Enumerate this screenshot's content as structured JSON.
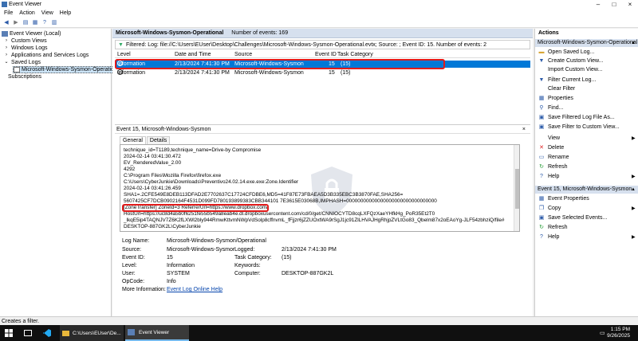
{
  "window": {
    "title": "Event Viewer"
  },
  "menu": [
    "File",
    "Action",
    "View",
    "Help"
  ],
  "tree": {
    "root": "Event Viewer (Local)",
    "items": [
      "Custom Views",
      "Windows Logs",
      "Applications and Services Logs",
      "Saved Logs"
    ],
    "selected": "Microsoft-Windows-Sysmon-Operational",
    "subscriptions": "Subscriptions"
  },
  "log": {
    "name": "Microsoft-Windows-Sysmon-Operational",
    "count_text": "Number of events: 169",
    "filter_text": "Filtered: Log: file://C:\\Users\\EUser\\Desktop\\Challenges\\Microsoft-Windows-Sysmon-Operational.evtx; Source: ; Event ID: 15. Number of events: 2",
    "columns": [
      "Level",
      "Date and Time",
      "Source",
      "Event ID",
      "Task Category"
    ],
    "rows": [
      {
        "level": "Information",
        "date": "2/13/2024 7:41:30 PM",
        "source": "Microsoft-Windows-Sysmon",
        "id": "15",
        "task": "(15)"
      },
      {
        "level": "Information",
        "date": "2/13/2024 7:41:30 PM",
        "source": "Microsoft-Windows-Sysmon",
        "id": "15",
        "task": "(15)"
      }
    ]
  },
  "detail": {
    "title": "Event 15, Microsoft-Windows-Sysmon",
    "close": "×",
    "tabs": [
      "General",
      "Details"
    ],
    "lines": [
      "technique_id=T1189,technique_name=Drive-by Compromise",
      "2024-02-14 03:41:30.472",
      "EV_RenderedValue_2.00",
      "4292",
      "C:\\Program Files\\Mozilla Firefox\\firefox.exe",
      "C:\\Users\\CyberJunkie\\Downloads\\Preventivo24.02.14.exe.exe:Zone.Identifier",
      "2024-02-14 03:41:26.459",
      "SHA1=.2CFE549E8DEB113DFAD2E7702637C17724CFDBE6,MD5=41F87E73FBAEA5D3B335EBC3B3870FAE,SHA256=",
      "5607425CF7DCB0902164F4531D099FD780193899383CBB344101 7E3615E03068B,IMPHASH=00000000000000000000000000000000",
      "[ZoneTransfer]  ZoneId=3  ReferrerUrl=https://www.dropbox.com/",
      "HostUrl=https://uc8d4a5b0f6251fe55b549a8eab4e.dl.dropboxusercontent.com/cd/0/get/CNNIOCYTD8cqLXFQzXaeYHfkHg_PoR35Et2T0",
      "_lkqE5ip4TAQNJV7Z6K2fLXWl2bly944RmwKttvmNWpVdSolp8cffnvmL_fFjjzr6jZZUOxtWA9rSgJ1jc91ZlLHVAJHgRhjpZVLtGo83_Qbelm87x2oEAoYg-JLF54zbhziQ/file#",
      "DESKTOP-887GK2L\\CyberJunkie"
    ],
    "props": {
      "log_name_k": "Log Name:",
      "log_name_v": "Microsoft-Windows-Sysmon/Operational",
      "source_k": "Source:",
      "source_v": "Microsoft-Windows-Sysmor",
      "logged_k": "Logged:",
      "logged_v": "2/13/2024 7:41:30 PM",
      "eventid_k": "Event ID:",
      "eventid_v": "15",
      "task_k": "Task Category:",
      "task_v": "(15)",
      "level_k": "Level:",
      "level_v": "Information",
      "keywords_k": "Keywords:",
      "keywords_v": "",
      "user_k": "User:",
      "user_v": "SYSTEM",
      "computer_k": "Computer:",
      "computer_v": "DESKTOP-887GK2L",
      "opcode_k": "OpCode:",
      "opcode_v": "Info",
      "more_k": "More Information:",
      "more_v": "Event Log Online Help"
    }
  },
  "actions": {
    "header": "Actions",
    "section1": "Microsoft-Windows-Sysmon-Operational",
    "items1": [
      "Open Saved Log...",
      "Create Custom View...",
      "Import Custom View...",
      "Filter Current Log...",
      "Clear Filter",
      "Properties",
      "Find...",
      "Save Filtered Log File As...",
      "Save Filter to Custom View...",
      "View",
      "Delete",
      "Rename",
      "Refresh",
      "Help"
    ],
    "section2": "Event 15, Microsoft-Windows-Sysmon",
    "items2": [
      "Event Properties",
      "Copy",
      "Save Selected Events...",
      "Refresh",
      "Help"
    ]
  },
  "status": "Creates a filter.",
  "taskbar": {
    "explorer": "C:\\Users\\EUser\\De...",
    "app": "Event Viewer",
    "time": "1:15 PM",
    "date": "9/26/2025"
  },
  "colors": {
    "selection": "#0078d7",
    "highlight_box": "#e21b1b",
    "header_band": "#d6e0ee"
  }
}
